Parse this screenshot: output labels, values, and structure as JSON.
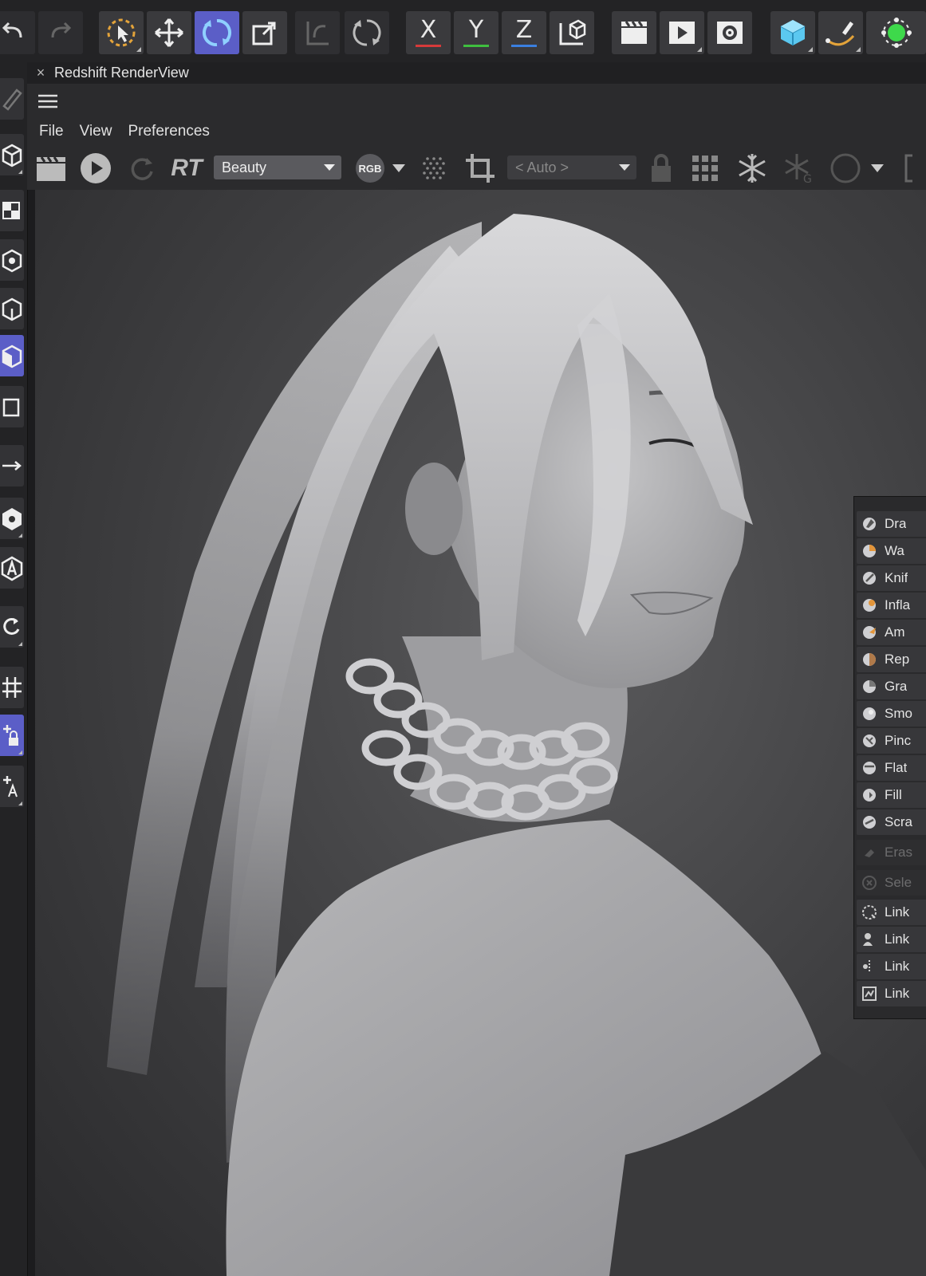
{
  "window": {
    "title": "Redshift RenderView",
    "close_glyph": "×"
  },
  "top_toolbar": {
    "buttons": [
      {
        "icon": "undo-icon"
      },
      {
        "icon": "redo-icon"
      },
      {
        "icon": "live-selection-icon"
      },
      {
        "icon": "move-icon"
      },
      {
        "icon": "rotate-icon",
        "active": true
      },
      {
        "icon": "scale-icon"
      },
      {
        "icon": "undo-view-icon"
      },
      {
        "icon": "redo-view-icon"
      },
      {
        "icon": "x-axis",
        "label": "X",
        "color": "#d63a3a"
      },
      {
        "icon": "y-axis",
        "label": "Y",
        "color": "#3fbf3f"
      },
      {
        "icon": "z-axis",
        "label": "Z",
        "color": "#3a7fe0"
      },
      {
        "icon": "coordinate-system-icon"
      },
      {
        "icon": "render-view-icon"
      },
      {
        "icon": "render-to-picture-viewer-icon"
      },
      {
        "icon": "render-settings-icon"
      },
      {
        "icon": "cube-icon"
      },
      {
        "icon": "pen-spline-icon"
      },
      {
        "icon": "generator-icon"
      }
    ]
  },
  "menu": {
    "file": "File",
    "view": "View",
    "preferences": "Preferences"
  },
  "render_toolbar": {
    "rt_label": "RT",
    "aov_value": "Beauty",
    "color_mode": "RGB",
    "region_value": "< Auto >"
  },
  "brushes": [
    {
      "label": "Draw",
      "visible": "Dra"
    },
    {
      "label": "Wax",
      "visible": "Wa"
    },
    {
      "label": "Knife",
      "visible": "Knif"
    },
    {
      "label": "Inflate",
      "visible": "Infla"
    },
    {
      "label": "Amplify",
      "visible": "Am"
    },
    {
      "label": "Repeat",
      "visible": "Rep"
    },
    {
      "label": "Grab",
      "visible": "Gra"
    },
    {
      "label": "Smooth",
      "visible": "Smo"
    },
    {
      "label": "Pinch",
      "visible": "Pinc"
    },
    {
      "label": "Flatten",
      "visible": "Flat"
    },
    {
      "label": "Fill",
      "visible": "Fill"
    },
    {
      "label": "Scrape",
      "visible": "Scra"
    },
    {
      "label": "Erase",
      "visible": "Eras",
      "disabled": true
    },
    {
      "label": "Select",
      "visible": "Sele",
      "disabled": true
    },
    {
      "label": "Link",
      "visible": "Link"
    },
    {
      "label": "Link",
      "visible": "Link"
    },
    {
      "label": "Link",
      "visible": "Link"
    },
    {
      "label": "Link",
      "visible": "Link"
    }
  ],
  "colors": {
    "accent_active": "#5b5ec7",
    "axis_x": "#d63a3a",
    "axis_y": "#3fbf3f",
    "axis_z": "#3a7fe0",
    "cube": "#5bc8f0",
    "generator": "#3ed94b"
  }
}
